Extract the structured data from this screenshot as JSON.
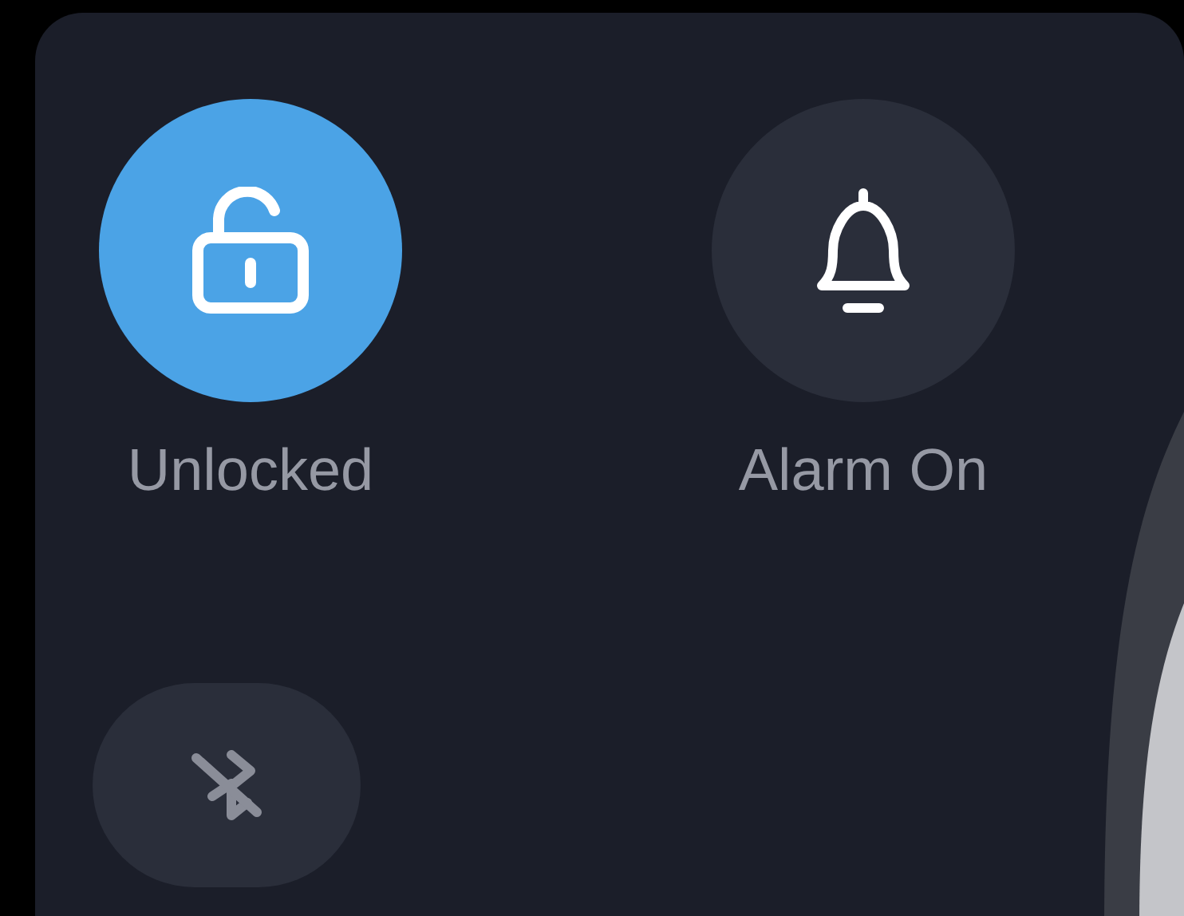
{
  "tiles": [
    {
      "kind": "lock",
      "label": "Unlocked",
      "on": true
    },
    {
      "kind": "bell",
      "label": "Alarm On",
      "on": false
    }
  ],
  "bluetooth": {
    "on": false
  }
}
